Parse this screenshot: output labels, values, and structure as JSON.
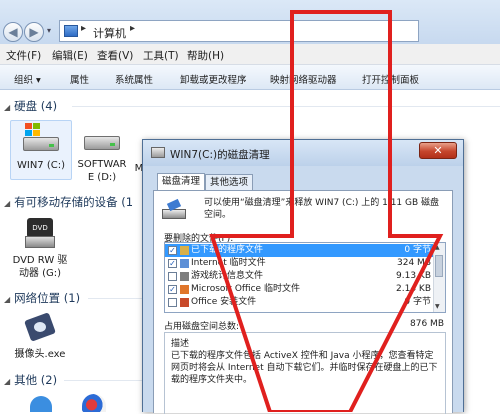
{
  "explorer": {
    "address": {
      "path_label": "计算机",
      "sep1": "▸",
      "sep2": "▸"
    },
    "nav": {
      "back": "◀",
      "forward": "▶",
      "dropdown": "▾"
    },
    "menu": [
      "文件(F)",
      "编辑(E)",
      "查看(V)",
      "工具(T)",
      "帮助(H)"
    ],
    "toolbar": [
      "组织 ▾",
      "属性",
      "系统属性",
      "卸载或更改程序",
      "映射网络驱动器",
      "打开控制面板"
    ],
    "groups": {
      "disks": "硬盘 (4)",
      "removable": "有可移动存储的设备 (1",
      "network": "网络位置 (1)",
      "other": "其他 (2)"
    },
    "items": {
      "win7": "WIN7 (C:)",
      "software": "SOFTWAR E (D:)",
      "partial_m": "M",
      "dvd_label": "DVD",
      "dvd": "DVD RW 驱动器 (G:)",
      "camera": "摄像头.exe"
    }
  },
  "dialog": {
    "title": "WIN7(C:)的磁盘清理",
    "close": "✕",
    "tabs": [
      "磁盘清理",
      "其他选项"
    ],
    "description": "可以使用“磁盘清理”来释放 WIN7 (C:) 上的 1.11 GB 磁盘空间。",
    "list_label": "要删除的文件(F):",
    "files": [
      {
        "name": "已下载的程序文件",
        "size": "0 字节",
        "checked": true
      },
      {
        "name": "Internet 临时文件",
        "size": "324 MB",
        "checked": true
      },
      {
        "name": "游戏统计信息文件",
        "size": "9.13 KB",
        "checked": false
      },
      {
        "name": "Microsoft Office 临时文件",
        "size": "2.14 KB",
        "checked": true
      },
      {
        "name": "Office 安装文件",
        "size": "0 字节",
        "checked": false
      }
    ],
    "total_label": "占用磁盘空间总数:",
    "total_value": "876 MB",
    "desc_title": "描述",
    "desc_text": "已下载的程序文件包括 ActiveX 控件和 Java 小程序，您查看特定网页时将会从 Internet 自动下载它们。并临时保存在硬盘上的已下载的程序文件夹中。"
  },
  "colors": {
    "arrow": "#e0201e",
    "selection": "#3399ff",
    "close": "#c6462c"
  },
  "icons": [
    "back-icon",
    "forward-icon",
    "computer-icon",
    "drive-icon",
    "dvd-icon",
    "camera-icon",
    "checkbox-icon",
    "red-arrow-annotation"
  ]
}
